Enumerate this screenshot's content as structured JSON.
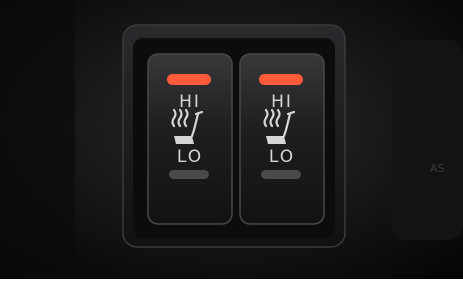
{
  "switches": [
    {
      "hi_label": "HI",
      "lo_label": "LO",
      "icon": "heated-seat-icon",
      "hi_indicator_on": true,
      "lo_indicator_on": false
    },
    {
      "hi_label": "HI",
      "lo_label": "LO",
      "icon": "heated-seat-icon",
      "hi_indicator_on": true,
      "lo_indicator_on": false
    }
  ],
  "colors": {
    "indicator_on": "#ff5a3a",
    "indicator_off": "#4a4a4a",
    "label": "#d6d6d6",
    "panel": "#1e1e20"
  }
}
